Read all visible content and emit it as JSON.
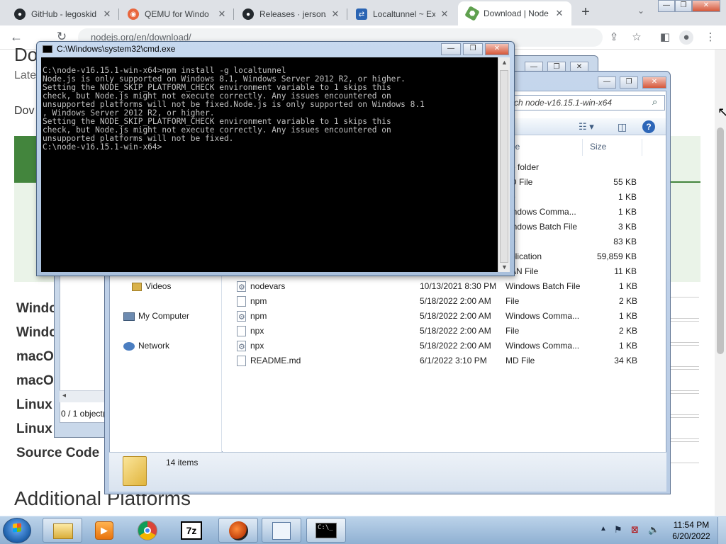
{
  "browser": {
    "tabs": [
      {
        "title": "GitHub - legoskid",
        "favicon": "github-icon"
      },
      {
        "title": "QEMU for Windo",
        "favicon": "qemu-icon"
      },
      {
        "title": "Releases · jerson/",
        "favicon": "github-icon"
      },
      {
        "title": "Localtunnel ~ Exp",
        "favicon": "localtunnel-icon"
      },
      {
        "title": "Download | Node",
        "favicon": "nodejs-icon",
        "active": true
      }
    ],
    "new_tab": "+",
    "tab_search": "⌄",
    "address": "nodejs.org/en/download/",
    "window_controls": {
      "minimize": "—",
      "maximize": "❐",
      "close": "✕"
    }
  },
  "webpage": {
    "heading_partial": "Do",
    "latest_partial": "Late",
    "downloads_partial": "Dov",
    "platform_rows": [
      "Windo",
      "Windo",
      "macO",
      "macO",
      "Linux",
      "Linux Binaries",
      "Source Code"
    ],
    "additional_platforms": "Additional Platforms",
    "accent_green": "#43853d"
  },
  "explorer_back": {
    "status": "0 / 1 object(s"
  },
  "explorer": {
    "search_placeholder": "rch node-v16.15.1-win-x64",
    "columns": {
      "type": "pe",
      "size": "Size"
    },
    "nav": [
      {
        "label": "Videos",
        "icon": "videos-folder-icon"
      },
      {
        "label": "My Computer",
        "icon": "computer-icon"
      },
      {
        "label": "Network",
        "icon": "network-icon"
      }
    ],
    "files_partial": [
      {
        "type": "e folder",
        "size": ""
      },
      {
        "type": "D File",
        "size": "55 KB"
      },
      {
        "type": "e",
        "size": "1 KB"
      },
      {
        "type": "indows Comma...",
        "size": "1 KB"
      },
      {
        "type": "indows Batch File",
        "size": "3 KB"
      },
      {
        "type": "e",
        "size": "83 KB"
      },
      {
        "type": "plication",
        "size": "59,859 KB"
      },
      {
        "type": "AN File",
        "size": "11 KB"
      }
    ],
    "files": [
      {
        "name": "nodevars",
        "date": "10/13/2021 8:30 PM",
        "type": "Windows Batch File",
        "size": "1 KB",
        "icon": "batch-file-icon"
      },
      {
        "name": "npm",
        "date": "5/18/2022 2:00 AM",
        "type": "File",
        "size": "2 KB",
        "icon": "file-icon"
      },
      {
        "name": "npm",
        "date": "5/18/2022 2:00 AM",
        "type": "Windows Comma...",
        "size": "1 KB",
        "icon": "cmd-file-icon"
      },
      {
        "name": "npx",
        "date": "5/18/2022 2:00 AM",
        "type": "File",
        "size": "2 KB",
        "icon": "file-icon"
      },
      {
        "name": "npx",
        "date": "5/18/2022 2:00 AM",
        "type": "Windows Comma...",
        "size": "1 KB",
        "icon": "cmd-file-icon"
      },
      {
        "name": "README.md",
        "date": "6/1/2022 3:10 PM",
        "type": "MD File",
        "size": "34 KB",
        "icon": "file-icon"
      }
    ],
    "item_count": "14 items"
  },
  "cmd": {
    "title": "C:\\Windows\\system32\\cmd.exe",
    "lines": [
      "C:\\node-v16.15.1-win-x64>npm install -g localtunnel",
      "Node.js is only supported on Windows 8.1, Windows Server 2012 R2, or higher.",
      "Setting the NODE_SKIP_PLATFORM_CHECK environment variable to 1 skips this",
      "check, but Node.js might not execute correctly. Any issues encountered on",
      "unsupported platforms will not be fixed.Node.js is only supported on Windows 8.1",
      ", Windows Server 2012 R2, or higher.",
      "Setting the NODE_SKIP_PLATFORM_CHECK environment variable to 1 skips this",
      "check, but Node.js might not execute correctly. Any issues encountered on",
      "unsupported platforms will not be fixed.",
      "C:\\node-v16.15.1-win-x64>"
    ]
  },
  "taskbar": {
    "apps": [
      "explorer-icon",
      "media-player-icon",
      "chrome-icon",
      "7zip-icon",
      "qemu-icon",
      "notepad-icon",
      "cmd-icon"
    ],
    "seven_zip_label": "7z",
    "cmd_label": "C:\\_",
    "time": "11:54 PM",
    "date": "6/20/2022"
  }
}
